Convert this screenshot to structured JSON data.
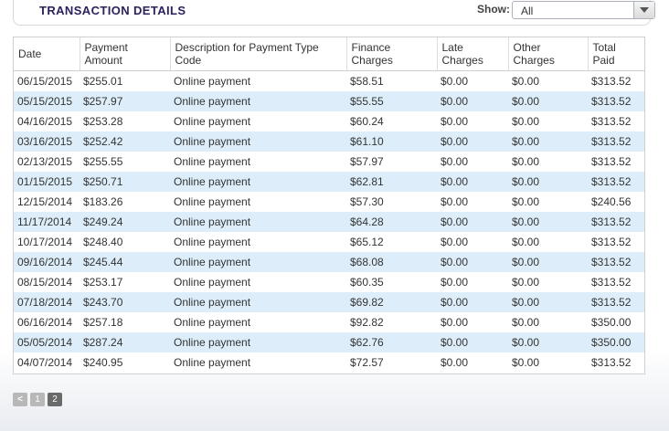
{
  "header": {
    "title": "TRANSACTION DETAILS",
    "show_label": "Show:",
    "show_value": "All"
  },
  "table": {
    "columns": [
      "Date",
      "Payment Amount",
      "Description for Payment Type Code",
      "Finance Charges",
      "Late Charges",
      "Other Charges",
      "Total Paid"
    ],
    "rows": [
      [
        "06/15/2015",
        "$255.01",
        "Online payment",
        "$58.51",
        "$0.00",
        "$0.00",
        "$313.52"
      ],
      [
        "05/15/2015",
        "$257.97",
        "Online payment",
        "$55.55",
        "$0.00",
        "$0.00",
        "$313.52"
      ],
      [
        "04/16/2015",
        "$253.28",
        "Online payment",
        "$60.24",
        "$0.00",
        "$0.00",
        "$313.52"
      ],
      [
        "03/16/2015",
        "$252.42",
        "Online payment",
        "$61.10",
        "$0.00",
        "$0.00",
        "$313.52"
      ],
      [
        "02/13/2015",
        "$255.55",
        "Online payment",
        "$57.97",
        "$0.00",
        "$0.00",
        "$313.52"
      ],
      [
        "01/15/2015",
        "$250.71",
        "Online payment",
        "$62.81",
        "$0.00",
        "$0.00",
        "$313.52"
      ],
      [
        "12/15/2014",
        "$183.26",
        "Online payment",
        "$57.30",
        "$0.00",
        "$0.00",
        "$240.56"
      ],
      [
        "11/17/2014",
        "$249.24",
        "Online payment",
        "$64.28",
        "$0.00",
        "$0.00",
        "$313.52"
      ],
      [
        "10/17/2014",
        "$248.40",
        "Online payment",
        "$65.12",
        "$0.00",
        "$0.00",
        "$313.52"
      ],
      [
        "09/16/2014",
        "$245.44",
        "Online payment",
        "$68.08",
        "$0.00",
        "$0.00",
        "$313.52"
      ],
      [
        "08/15/2014",
        "$253.17",
        "Online payment",
        "$60.35",
        "$0.00",
        "$0.00",
        "$313.52"
      ],
      [
        "07/18/2014",
        "$243.70",
        "Online payment",
        "$69.82",
        "$0.00",
        "$0.00",
        "$313.52"
      ],
      [
        "06/16/2014",
        "$257.18",
        "Online payment",
        "$92.82",
        "$0.00",
        "$0.00",
        "$350.00"
      ],
      [
        "05/05/2014",
        "$287.24",
        "Online payment",
        "$62.76",
        "$0.00",
        "$0.00",
        "$350.00"
      ],
      [
        "04/07/2014",
        "$240.95",
        "Online payment",
        "$72.57",
        "$0.00",
        "$0.00",
        "$313.52"
      ]
    ]
  },
  "pagination": {
    "prev_label": "<",
    "pages": [
      "1",
      "2"
    ],
    "current": "2"
  }
}
